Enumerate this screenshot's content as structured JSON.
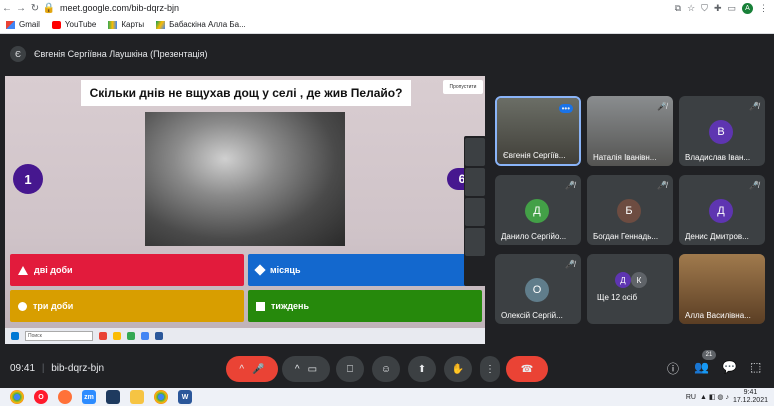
{
  "browser": {
    "url": "meet.google.com/bib-dqrz-bjn",
    "bookmarks": [
      {
        "label": "Gmail",
        "icon": "gmail-icon"
      },
      {
        "label": "YouTube",
        "icon": "youtube-icon"
      },
      {
        "label": "Карты",
        "icon": "maps-icon"
      },
      {
        "label": "Бабаскіна Алла Ба...",
        "icon": "drive-icon"
      }
    ],
    "profile_initial": "A"
  },
  "presentation": {
    "presenter_initial": "Є",
    "title": "Євгенія Сергіївна Лаушкіна (Презентація)"
  },
  "quiz": {
    "question": "Скільки днів не вщухав дощ у селі , де жив Пелайо?",
    "skip_label": "Пропустити",
    "timer_left": "1",
    "answers_count": "6",
    "answers": [
      {
        "label": "дві доби",
        "color": "#e21b3c",
        "shape": "triangle"
      },
      {
        "label": "місяць",
        "color": "#1368ce",
        "shape": "diamond"
      },
      {
        "label": "три доби",
        "color": "#d89e00",
        "shape": "circle"
      },
      {
        "label": "тиждень",
        "color": "#26890c",
        "shape": "square"
      }
    ],
    "mini_search": "Поиск"
  },
  "participants": [
    {
      "name": "Євгенія Сергіїв...",
      "type": "photo",
      "muted": false,
      "has_more": true
    },
    {
      "name": "Наталія Іванівн...",
      "type": "photo",
      "muted": true
    },
    {
      "name": "Владислав Іван...",
      "type": "avatar",
      "initial": "В",
      "color": "#5e35b1",
      "muted": true
    },
    {
      "name": "Данило Сергійо...",
      "type": "avatar",
      "initial": "Д",
      "color": "#43a047",
      "muted": true
    },
    {
      "name": "Богдан Геннадь...",
      "type": "avatar",
      "initial": "Б",
      "color": "#6d4c41",
      "muted": true
    },
    {
      "name": "Денис Дмитров...",
      "type": "avatar",
      "initial": "Д",
      "color": "#5e35b1",
      "muted": true
    },
    {
      "name": "Олексій Сергій...",
      "type": "avatar",
      "initial": "О",
      "color": "#607d8b",
      "muted": true
    },
    {
      "name": "Ще 12 осіб",
      "type": "more",
      "initials": [
        "Д",
        "К"
      ]
    },
    {
      "name": "Алла Василівна...",
      "type": "photo",
      "muted": false
    }
  ],
  "controls": {
    "time": "09:41",
    "meeting_code": "bib-dqrz-bjn",
    "people_count": "21"
  },
  "taskbar": {
    "lang": "RU",
    "time": "9:41",
    "date": "17.12.2021"
  }
}
